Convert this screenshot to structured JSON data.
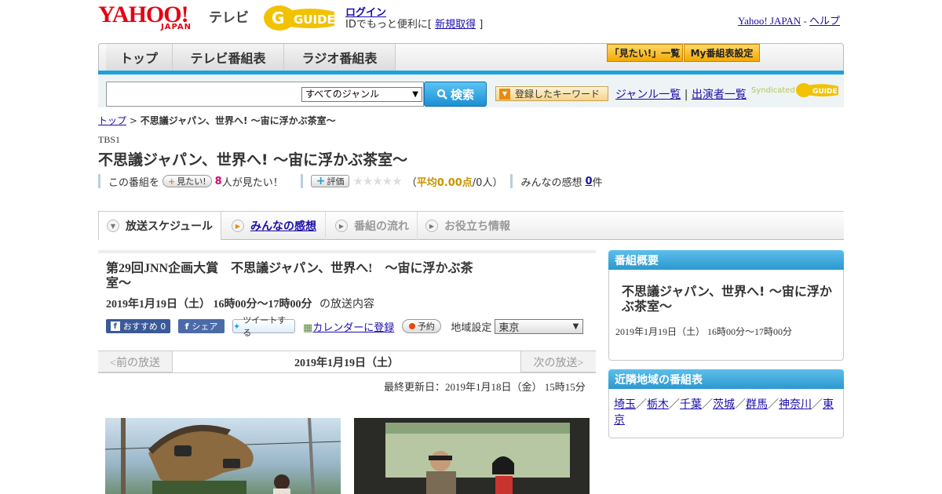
{
  "header": {
    "logo_yahoo": "YAHOO!",
    "logo_japan": "JAPAN",
    "logo_tv": "テレビ",
    "logo_gguide": "G GUIDE",
    "login_link": "ログイン",
    "id_note_prefix": "IDでもっと便利に[",
    "signup_link": "新規取得",
    "id_note_suffix": "]",
    "yahoo_japan_link": "Yahoo! JAPAN",
    "separator": "-",
    "help_link": "ヘルプ"
  },
  "nav": {
    "tabs": [
      "トップ",
      "テレビ番組表",
      "ラジオ番組表"
    ],
    "miru_list_label": "「見たい!」一覧",
    "my_schedule_label": "My番組表設定"
  },
  "search": {
    "genre_selected": "すべてのジャンル",
    "search_button": "検索",
    "keyword_button": "登録したキーワード",
    "genre_list_link": "ジャンル一覧",
    "pipe": "|",
    "performer_list_link": "出演者一覧",
    "syndicated": "Syndicated"
  },
  "breadcrumb": {
    "top_link": "トップ",
    "sep": ">",
    "current": "不思議ジャパン、世界へ! ～宙に浮かぶ茶室～"
  },
  "program": {
    "channel": "TBS1",
    "title": "不思議ジャパン、世界へ! ～宙に浮かぶ茶室～",
    "this_program": "この番組を",
    "miru_button": "見たい!",
    "want_count": "8",
    "want_suffix": "人が見たい！",
    "rate_button": "評価",
    "avg_prefix": "（",
    "avg_label": "平均0.00点",
    "avg_suffix": "/0人）",
    "impressions_label": "みんなの感想",
    "impressions_count": "0",
    "impressions_unit": "件",
    "rating_stars": 0
  },
  "tabs": [
    {
      "label": "放送スケジュール",
      "active": true
    },
    {
      "label": "みんなの感想",
      "active": false
    },
    {
      "label": "番組の流れ",
      "active": false
    },
    {
      "label": "お役立ち情報",
      "active": false
    }
  ],
  "broadcast": {
    "title": "第29回JNN企画大賞　不思議ジャパン、世界へ!　～宙に浮かぶ茶室～",
    "date": "2019年1月19日（土）  16時00分～17時00分",
    "date_suffix": "の放送内容",
    "fb_recommend": "おすすめ 0",
    "fb_share": "シェア",
    "tweet": "ツイートする",
    "calendar_link": "カレンダーに登録",
    "reserve": "予約",
    "region_label": "地域設定",
    "region_selected": "東京"
  },
  "pager": {
    "prev": "<前の放送",
    "date": "2019年1月19日（土）",
    "next": "次の放送>"
  },
  "updated": "最終更新日：2019年1月18日（金）  15時15分",
  "sidebar": {
    "overview_header": "番組概要",
    "overview_title": "不思議ジャパン、世界へ! ～宙に浮かぶ茶室～",
    "overview_date": "2019年1月19日（土）  16時00分～17時00分",
    "nearby_header": "近隣地域の番組表",
    "nearby_regions": [
      "埼玉",
      "栃木",
      "千葉",
      "茨城",
      "群馬",
      "神奈川",
      "東京"
    ],
    "region_sep": "／"
  },
  "colors": {
    "accent_blue": "#1aa3db",
    "brand_red": "#e60012",
    "gguide_yellow": "#f2c200",
    "want_count": "#d8006b"
  }
}
